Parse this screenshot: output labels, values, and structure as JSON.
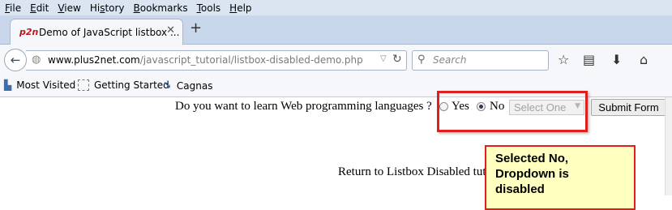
{
  "menu": [
    {
      "hot": "F",
      "rest": "ile"
    },
    {
      "hot": "E",
      "rest": "dit"
    },
    {
      "hot": "V",
      "rest": "iew"
    },
    {
      "hot": "",
      "rest": "Hi",
      "hot2": "s",
      "rest2": "tory"
    },
    {
      "hot": "B",
      "rest": "ookmarks"
    },
    {
      "hot": "T",
      "rest": "ools"
    },
    {
      "hot": "H",
      "rest": "elp"
    }
  ],
  "tab": {
    "favicon_text": "p2n",
    "title": "Demo of JavaScript listbox ...",
    "close": "✕",
    "new_tab": "+"
  },
  "nav": {
    "url_host": "www.plus2net.com",
    "url_path": "/javascript_tutorial/listbox-disabled-demo.php",
    "search_placeholder": "Search"
  },
  "bookmarks": [
    {
      "label": "Most Visited",
      "icon": "bookmark-icon"
    },
    {
      "label": "Getting Started",
      "icon": "page-icon"
    },
    {
      "label": "Cagnas",
      "icon": "cagnas-icon"
    }
  ],
  "form": {
    "question": "Do you want to learn Web programming languages ?",
    "option_yes": "Yes",
    "option_no": "No",
    "select_value": "Select One",
    "submit_label": "Submit Form"
  },
  "return_link": "Return to Listbox Disabled tut",
  "callout": {
    "line1": "Selected No,",
    "line2": "Dropdown is",
    "line3": "disabled"
  },
  "colors": {
    "highlight": "#e01e1e",
    "callout_bg": "#ffffc0"
  }
}
